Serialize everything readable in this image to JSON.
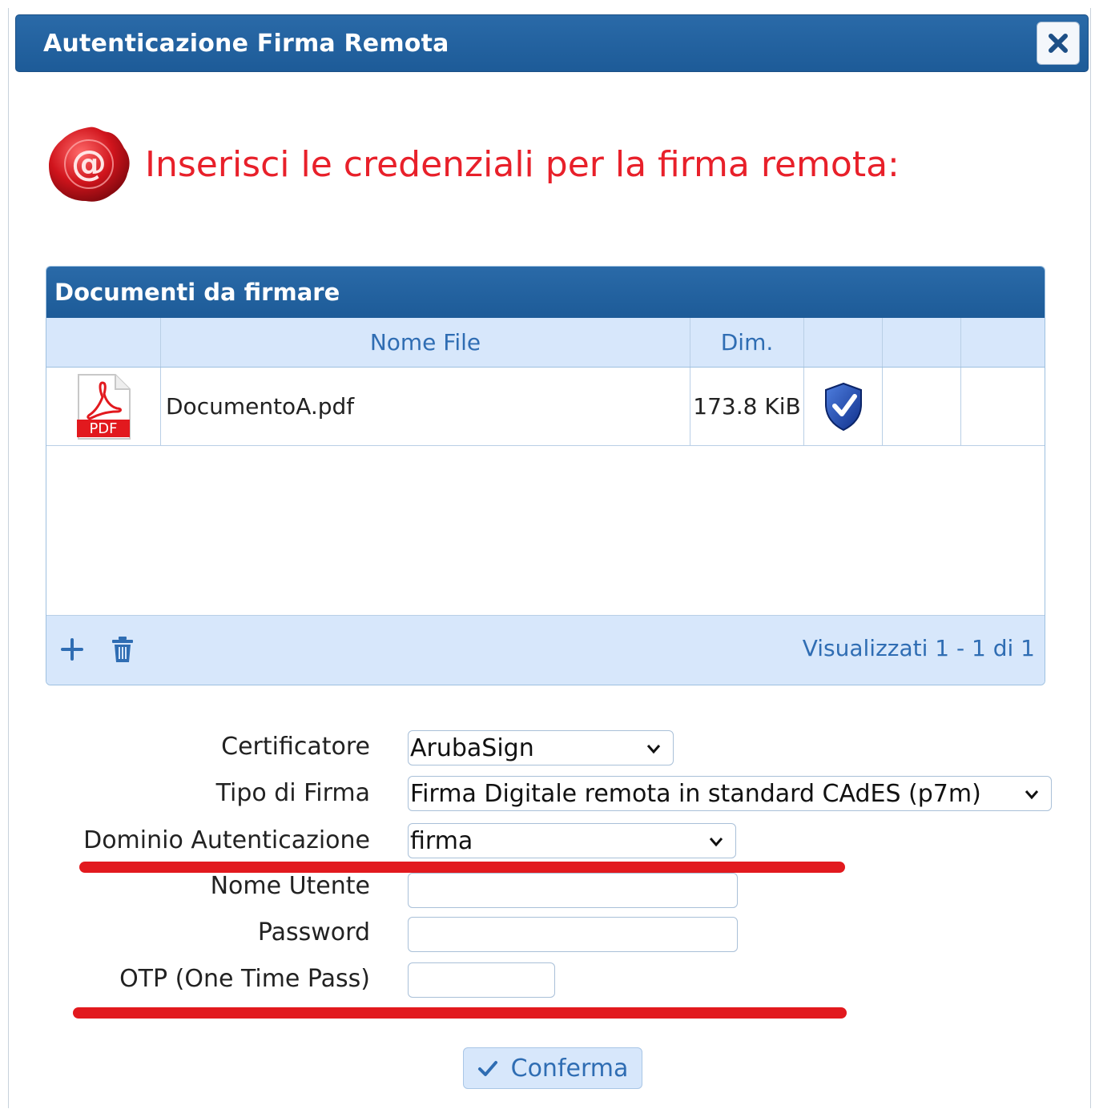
{
  "dialog": {
    "title": "Autenticazione Firma Remota",
    "close_icon": "close-icon"
  },
  "heading": {
    "icon": "seal-at-icon",
    "text": "Inserisci le credenziali per la firma remota:"
  },
  "grid": {
    "title": "Documenti da firmare",
    "columns": [
      "",
      "Nome File",
      "Dim.",
      "",
      "",
      ""
    ],
    "rows": [
      {
        "icon": "pdf-icon",
        "icon_label": "PDF",
        "name": "DocumentoA.pdf",
        "size": "173.8 KiB",
        "status_icon": "verified-shield-icon"
      }
    ],
    "pager": "Visualizzati 1 - 1 di 1",
    "add_icon": "add-icon",
    "delete_icon": "trash-icon"
  },
  "form": {
    "certificatore": {
      "label": "Certificatore",
      "value": "ArubaSign"
    },
    "tipo_firma": {
      "label": "Tipo di Firma",
      "value": "Firma Digitale remota in standard CAdES (p7m)"
    },
    "dominio": {
      "label": "Dominio Autenticazione",
      "value": "firma"
    },
    "utente": {
      "label": "Nome Utente",
      "value": ""
    },
    "password": {
      "label": "Password",
      "value": ""
    },
    "otp": {
      "label": "OTP (One Time Pass)",
      "value": ""
    }
  },
  "confirm": {
    "label": "Conferma",
    "icon": "check-icon"
  },
  "colors": {
    "header_blue": "#1d5b98",
    "accent_red": "#e2191e",
    "link_blue": "#2f6db3",
    "grid_header_bg": "#d7e7fb"
  }
}
